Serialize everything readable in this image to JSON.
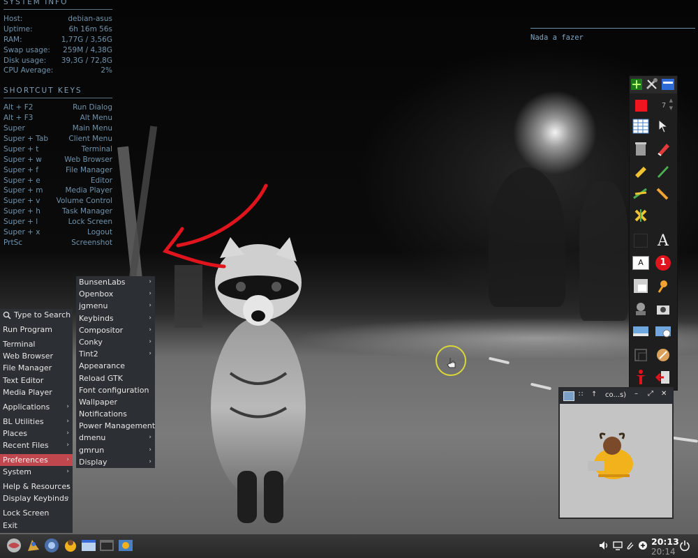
{
  "conky": {
    "system_header": "SYSTEM INFO",
    "system_rows": [
      {
        "label": "Host:",
        "value": "debian-asus"
      },
      {
        "label": "Uptime:",
        "value": "6h 16m 56s"
      },
      {
        "label": "RAM:",
        "value": "1,77G / 3,56G"
      },
      {
        "label": "Swap usage:",
        "value": "259M / 4,38G"
      },
      {
        "label": "Disk usage:",
        "value": "39,3G / 72,8G"
      },
      {
        "label": "CPU Average:",
        "value": "2%"
      }
    ],
    "shortcut_header": "SHORTCUT KEYS",
    "shortcut_rows": [
      {
        "label": "Alt + F2",
        "value": "Run Dialog"
      },
      {
        "label": "Alt + F3",
        "value": "Alt Menu"
      },
      {
        "label": "Super",
        "value": "Main Menu"
      },
      {
        "label": "Super + Tab",
        "value": "Client Menu"
      },
      {
        "label": "Super + t",
        "value": "Terminal"
      },
      {
        "label": "Super + w",
        "value": "Web Browser"
      },
      {
        "label": "Super + f",
        "value": "File Manager"
      },
      {
        "label": "Super + e",
        "value": "Editor"
      },
      {
        "label": "Super + m",
        "value": "Media Player"
      },
      {
        "label": "Super + v",
        "value": "Volume Control"
      },
      {
        "label": "Super + h",
        "value": "Task Manager"
      },
      {
        "label": "Super + l",
        "value": "Lock Screen"
      },
      {
        "label": "Super + x",
        "value": "Logout"
      },
      {
        "label": "PrtSc",
        "value": "Screenshot"
      }
    ]
  },
  "todo": {
    "text": "Nada a fazer"
  },
  "main_menu": {
    "search_label": "Type to Search",
    "groups": [
      [
        {
          "label": "Run Program",
          "sub": false
        }
      ],
      [
        {
          "label": "Terminal",
          "sub": false
        },
        {
          "label": "Web Browser",
          "sub": false
        },
        {
          "label": "File Manager",
          "sub": false
        },
        {
          "label": "Text Editor",
          "sub": false
        },
        {
          "label": "Media Player",
          "sub": false
        }
      ],
      [
        {
          "label": "Applications",
          "sub": true
        }
      ],
      [
        {
          "label": "BL Utilities",
          "sub": true
        },
        {
          "label": "Places",
          "sub": true
        },
        {
          "label": "Recent Files",
          "sub": true
        }
      ],
      [
        {
          "label": "Preferences",
          "sub": true,
          "active": true
        },
        {
          "label": "System",
          "sub": true
        }
      ],
      [
        {
          "label": "Help & Resources",
          "sub": true
        },
        {
          "label": "Display Keybinds",
          "sub": true
        }
      ],
      [
        {
          "label": "Lock Screen",
          "sub": false
        },
        {
          "label": "Exit",
          "sub": false
        }
      ]
    ]
  },
  "prefs_menu": {
    "items": [
      {
        "label": "BunsenLabs",
        "sub": true
      },
      {
        "label": "Openbox",
        "sub": true
      },
      {
        "label": "jgmenu",
        "sub": true
      },
      {
        "label": "Keybinds",
        "sub": true
      },
      {
        "label": "Compositor",
        "sub": true
      },
      {
        "label": "Conky",
        "sub": true
      },
      {
        "label": "Tint2",
        "sub": true
      },
      {
        "label": "Appearance",
        "sub": false
      },
      {
        "label": "Reload GTK",
        "sub": false
      },
      {
        "label": "Font configuration",
        "sub": false
      },
      {
        "label": "Wallpaper",
        "sub": false
      },
      {
        "label": "Notifications",
        "sub": false
      },
      {
        "label": "Power Management",
        "sub": false
      },
      {
        "label": "dmenu",
        "sub": true
      },
      {
        "label": "gmrun",
        "sub": true
      },
      {
        "label": "Display",
        "sub": true
      }
    ]
  },
  "annotate": {
    "pen_size": "7",
    "number_badge": "1",
    "text_tool_label": "A",
    "font_tool_label": "A"
  },
  "miniwin": {
    "title": "co...s)"
  },
  "clock": {
    "time": "20:13",
    "time_shadow": "20:14"
  },
  "colors": {
    "accent": "#c0474d",
    "conky_text": "#6f93ad",
    "menu_bg": "#2c3035",
    "annotation_red": "#e0141c"
  }
}
